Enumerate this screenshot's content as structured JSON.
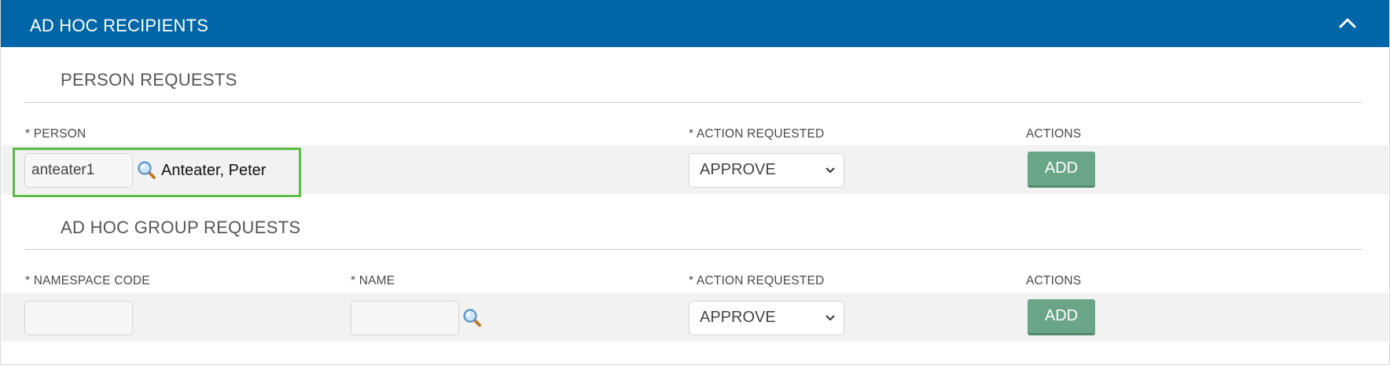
{
  "panel": {
    "title": "AD HOC RECIPIENTS"
  },
  "person_requests": {
    "section_title": "PERSON REQUESTS",
    "person_label": "* PERSON",
    "action_requested_label": "* ACTION REQUESTED",
    "actions_label": "ACTIONS",
    "person_value": "anteater1",
    "person_name": "Anteater, Peter",
    "action_value": "APPROVE",
    "add_label": "ADD"
  },
  "group_requests": {
    "section_title": "AD HOC GROUP REQUESTS",
    "namespace_label": "* NAMESPACE CODE",
    "name_label": "* NAME",
    "action_requested_label": "* ACTION REQUESTED",
    "actions_label": "ACTIONS",
    "namespace_value": "",
    "name_value": "",
    "action_value": "APPROVE",
    "add_label": "ADD"
  },
  "colors": {
    "header_bg": "#0066a8",
    "add_button": "#6aa587",
    "highlight": "#5cbd46"
  },
  "icons": {
    "collapse": "chevron-up-icon",
    "lookup": "magnifier-icon",
    "select": "chevron-down-icon"
  }
}
